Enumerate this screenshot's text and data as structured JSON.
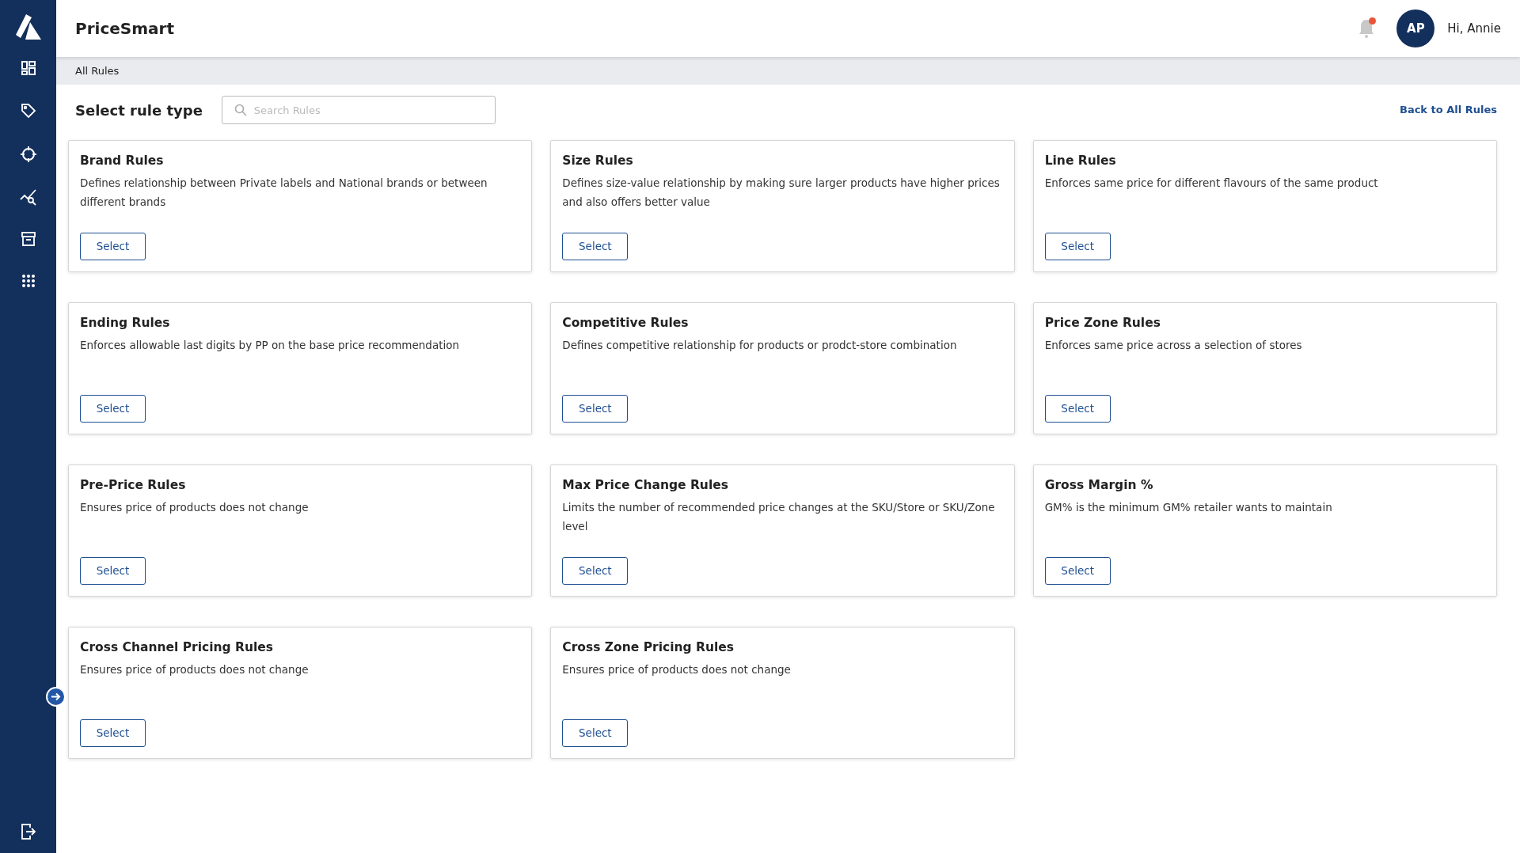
{
  "app": {
    "title": "PriceSmart"
  },
  "user": {
    "initials": "AP",
    "greeting": "Hi, Annie",
    "has_notification": true
  },
  "breadcrumb": "All Rules",
  "heading": "Select rule type",
  "search": {
    "placeholder": "Search Rules"
  },
  "back_link": "Back to All Rules",
  "rules": [
    {
      "title": "Brand Rules",
      "description": "Defines relationship between Private labels and National brands or between different brands",
      "button": "Select"
    },
    {
      "title": "Size Rules",
      "description": "Defines size-value relationship by making sure larger products have higher prices and also offers better value",
      "button": "Select"
    },
    {
      "title": "Line Rules",
      "description": "Enforces same price for different flavours of the same product",
      "button": "Select"
    },
    {
      "title": "Ending Rules",
      "description": "Enforces allowable last digits by PP on the base price recommendation",
      "button": "Select"
    },
    {
      "title": "Competitive Rules",
      "description": "Defines competitive relationship for products or prodct-store combination",
      "button": "Select"
    },
    {
      "title": "Price Zone Rules",
      "description": "Enforces same price across a selection of stores",
      "button": "Select"
    },
    {
      "title": "Pre-Price Rules",
      "description": "Ensures price of products does not change",
      "button": "Select"
    },
    {
      "title": "Max Price Change Rules",
      "description": "Limits the number of recommended price changes at the SKU/Store or SKU/Zone level",
      "button": "Select"
    },
    {
      "title": "Gross Margin %",
      "description": "GM% is the minimum GM% retailer wants to maintain",
      "button": "Select"
    },
    {
      "title": "Cross Channel Pricing Rules",
      "description": "Ensures price of products does not change",
      "button": "Select"
    },
    {
      "title": "Cross Zone Pricing Rules",
      "description": "Ensures price of products does not change",
      "button": "Select"
    }
  ]
}
